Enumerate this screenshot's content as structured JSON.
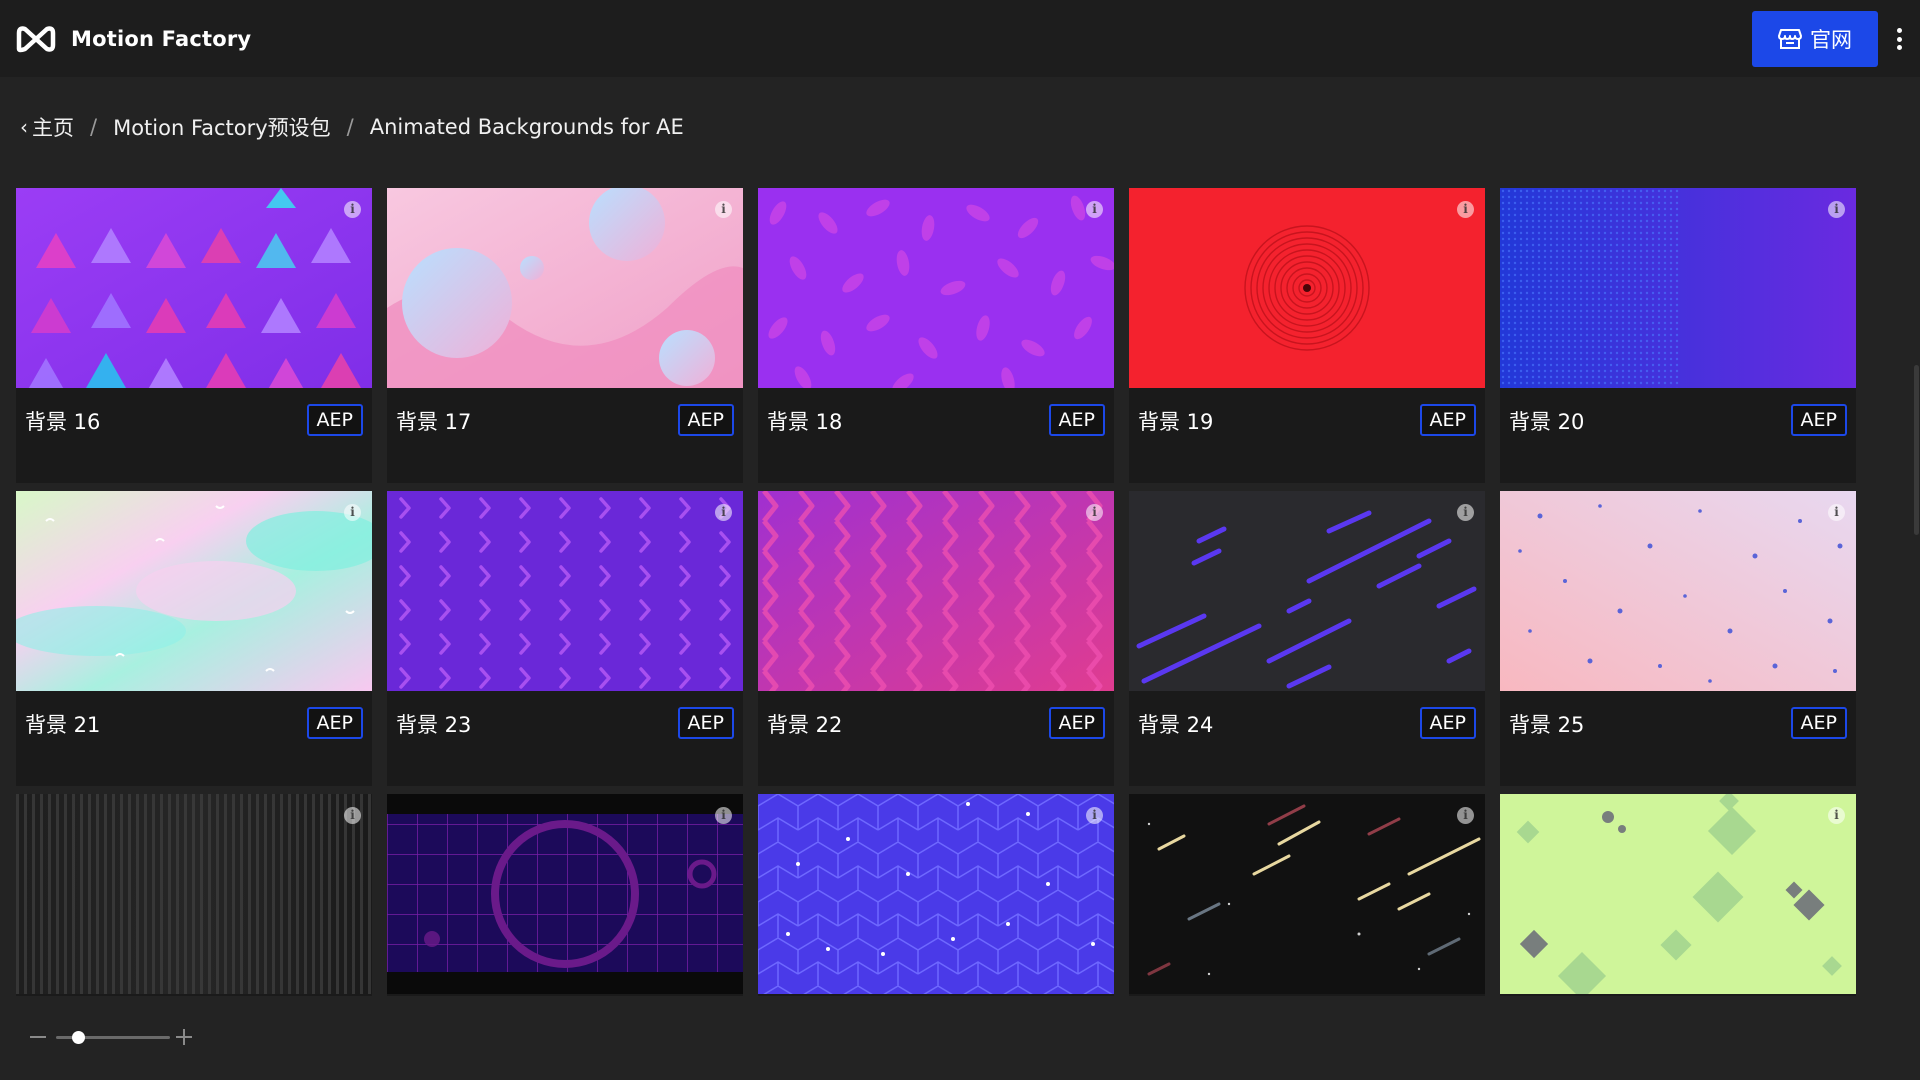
{
  "header": {
    "app_name": "Motion Factory",
    "official_site_label": "官网"
  },
  "breadcrumb": {
    "home": "主页",
    "pack": "Motion Factory预设包",
    "current": "Animated Backgrounds for AE"
  },
  "presets": [
    {
      "title": "背景 16",
      "format": "AEP",
      "thumbnail": "triangle-pattern-purple"
    },
    {
      "title": "背景 17",
      "format": "AEP",
      "thumbnail": "pastel-bubbles-pink"
    },
    {
      "title": "背景 18",
      "format": "AEP",
      "thumbnail": "purple-ovals"
    },
    {
      "title": "背景 19",
      "format": "AEP",
      "thumbnail": "red-concentric-rings"
    },
    {
      "title": "背景 20",
      "format": "AEP",
      "thumbnail": "blue-halftone-gradient"
    },
    {
      "title": "背景 21",
      "format": "AEP",
      "thumbnail": "holographic-pastel"
    },
    {
      "title": "背景 23",
      "format": "AEP",
      "thumbnail": "violet-chevrons"
    },
    {
      "title": "背景 22",
      "format": "AEP",
      "thumbnail": "magenta-zigzag"
    },
    {
      "title": "背景 24",
      "format": "AEP",
      "thumbnail": "dark-blue-streaks"
    },
    {
      "title": "背景 25",
      "format": "AEP",
      "thumbnail": "pink-dots"
    },
    {
      "title": "",
      "format": "",
      "thumbnail": "dark-vertical-lines"
    },
    {
      "title": "",
      "format": "",
      "thumbnail": "synthwave-grid-circle"
    },
    {
      "title": "",
      "format": "",
      "thumbnail": "blue-geometric-pattern"
    },
    {
      "title": "",
      "format": "",
      "thumbnail": "starfield-streaks"
    },
    {
      "title": "",
      "format": "",
      "thumbnail": "lime-diamonds"
    }
  ],
  "zoom": {
    "level": 0.2
  },
  "colors": {
    "accent": "#1c48e8",
    "background": "#232323",
    "header": "#1d1d1d"
  }
}
